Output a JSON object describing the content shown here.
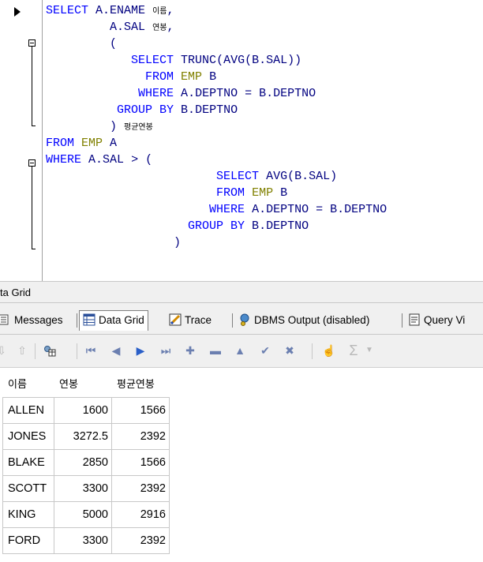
{
  "editor": {
    "lines": [
      {
        "indent": "",
        "tokens": [
          [
            "kw",
            "SELECT"
          ],
          [
            "id",
            " A"
          ],
          [
            "op",
            "."
          ],
          [
            "id",
            "ENAME "
          ],
          [
            "alias",
            "이름"
          ],
          [
            "op",
            ","
          ]
        ]
      },
      {
        "indent": "         ",
        "tokens": [
          [
            "id",
            "A"
          ],
          [
            "op",
            "."
          ],
          [
            "id",
            "SAL "
          ],
          [
            "alias",
            "연봉"
          ],
          [
            "op",
            ","
          ]
        ]
      },
      {
        "indent": "         ",
        "tokens": [
          [
            "op",
            "("
          ]
        ]
      },
      {
        "indent": "            ",
        "tokens": [
          [
            "kw",
            "SELECT"
          ],
          [
            "id",
            " TRUNC"
          ],
          [
            "op",
            "("
          ],
          [
            "id",
            "AVG"
          ],
          [
            "op",
            "("
          ],
          [
            "id",
            "B"
          ],
          [
            "op",
            "."
          ],
          [
            "id",
            "SAL"
          ],
          [
            "op",
            "))"
          ]
        ]
      },
      {
        "indent": "              ",
        "tokens": [
          [
            "kw",
            "FROM"
          ],
          [
            "tb",
            " EMP"
          ],
          [
            "id",
            " B"
          ]
        ]
      },
      {
        "indent": "             ",
        "tokens": [
          [
            "kw",
            "WHERE"
          ],
          [
            "id",
            " A"
          ],
          [
            "op",
            "."
          ],
          [
            "id",
            "DEPTNO "
          ],
          [
            "op",
            "="
          ],
          [
            "id",
            " B"
          ],
          [
            "op",
            "."
          ],
          [
            "id",
            "DEPTNO"
          ]
        ]
      },
      {
        "indent": "          ",
        "tokens": [
          [
            "kw",
            "GROUP BY"
          ],
          [
            "id",
            " B"
          ],
          [
            "op",
            "."
          ],
          [
            "id",
            "DEPTNO"
          ]
        ]
      },
      {
        "indent": "         ",
        "tokens": [
          [
            "op",
            ") "
          ],
          [
            "alias",
            "평균연봉"
          ]
        ]
      },
      {
        "indent": "",
        "tokens": [
          [
            "kw",
            "FROM"
          ],
          [
            "tb",
            " EMP"
          ],
          [
            "id",
            " A"
          ]
        ]
      },
      {
        "indent": "",
        "tokens": [
          [
            "kw",
            "WHERE"
          ],
          [
            "id",
            " A"
          ],
          [
            "op",
            "."
          ],
          [
            "id",
            "SAL "
          ],
          [
            "op",
            "> ("
          ]
        ]
      },
      {
        "indent": "                        ",
        "tokens": [
          [
            "kw",
            "SELECT"
          ],
          [
            "id",
            " AVG"
          ],
          [
            "op",
            "("
          ],
          [
            "id",
            "B"
          ],
          [
            "op",
            "."
          ],
          [
            "id",
            "SAL"
          ],
          [
            "op",
            ")"
          ]
        ]
      },
      {
        "indent": "                        ",
        "tokens": [
          [
            "kw",
            "FROM"
          ],
          [
            "tb",
            " EMP"
          ],
          [
            "id",
            " B"
          ]
        ]
      },
      {
        "indent": "                       ",
        "tokens": [
          [
            "kw",
            "WHERE"
          ],
          [
            "id",
            " A"
          ],
          [
            "op",
            "."
          ],
          [
            "id",
            "DEPTNO "
          ],
          [
            "op",
            "="
          ],
          [
            "id",
            " B"
          ],
          [
            "op",
            "."
          ],
          [
            "id",
            "DEPTNO"
          ]
        ]
      },
      {
        "indent": "                    ",
        "tokens": [
          [
            "kw",
            "GROUP BY"
          ],
          [
            "id",
            " B"
          ],
          [
            "op",
            "."
          ],
          [
            "id",
            "DEPTNO"
          ]
        ]
      },
      {
        "indent": "                  ",
        "tokens": [
          [
            "op",
            ")"
          ]
        ]
      }
    ]
  },
  "panel": {
    "title": "ta Grid"
  },
  "tabs": [
    {
      "icon": "messages-icon",
      "label": "Messages",
      "active": false
    },
    {
      "icon": "data-grid-icon",
      "label": "Data Grid",
      "active": true
    },
    {
      "icon": "trace-icon",
      "label": "Trace",
      "active": false
    },
    {
      "icon": "dbms-output-icon",
      "label": "DBMS Output (disabled)",
      "active": false
    },
    {
      "icon": "query-viewer-icon",
      "label": "Query Vi",
      "active": false
    }
  ],
  "toolbar": {
    "icons": [
      "export-icon",
      "upload-icon",
      "grid-options-icon",
      "first-record-icon",
      "prev-record-icon",
      "next-record-icon",
      "last-record-icon",
      "insert-record-icon",
      "delete-record-icon",
      "edit-record-icon",
      "post-edit-icon",
      "cancel-edit-icon",
      "hand-icon",
      "sum-icon",
      "dropdown-arrow-icon"
    ]
  },
  "grid": {
    "columns": [
      "이름",
      "연봉",
      "평균연봉"
    ],
    "rows": [
      [
        "ALLEN",
        "1600",
        "1566"
      ],
      [
        "JONES",
        "3272.5",
        "2392"
      ],
      [
        "BLAKE",
        "2850",
        "1566"
      ],
      [
        "SCOTT",
        "3300",
        "2392"
      ],
      [
        "KING",
        "5000",
        "2916"
      ],
      [
        "FORD",
        "3300",
        "2392"
      ]
    ]
  }
}
